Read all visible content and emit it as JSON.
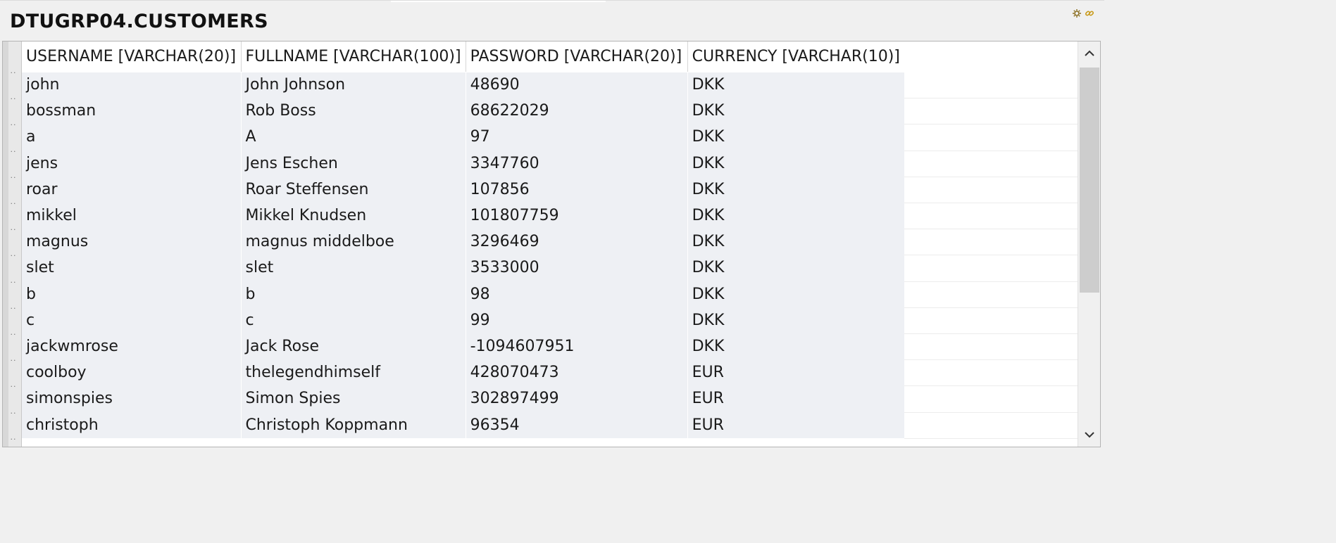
{
  "window": {
    "title": "DTUGRP04.CUSTOMERS"
  },
  "toolbar": {
    "icons": [
      "settings-icon",
      "link-icon"
    ]
  },
  "table": {
    "columns": [
      "USERNAME [VARCHAR(20)]",
      "FULLNAME [VARCHAR(100)]",
      "PASSWORD [VARCHAR(20)]",
      "CURRENCY [VARCHAR(10)]"
    ],
    "rows": [
      [
        "john",
        "John Johnson",
        "48690",
        "DKK"
      ],
      [
        "bossman",
        "Rob Boss",
        "68622029",
        "DKK"
      ],
      [
        "a",
        "A",
        "97",
        "DKK"
      ],
      [
        "jens",
        "Jens Eschen",
        "3347760",
        "DKK"
      ],
      [
        "roar",
        "Roar Steffensen",
        "107856",
        "DKK"
      ],
      [
        "mikkel",
        "Mikkel Knudsen",
        "101807759",
        "DKK"
      ],
      [
        "magnus",
        "magnus middelboe",
        "3296469",
        "DKK"
      ],
      [
        "slet",
        "slet",
        "3533000",
        "DKK"
      ],
      [
        "b",
        "b",
        "98",
        "DKK"
      ],
      [
        "c",
        "c",
        "99",
        "DKK"
      ],
      [
        "jackwmrose",
        "Jack Rose",
        "-1094607951",
        "DKK"
      ],
      [
        "coolboy",
        "thelegendhimself",
        "428070473",
        "EUR"
      ],
      [
        "simonspies",
        "Simon Spies",
        "302897499",
        "EUR"
      ],
      [
        "christoph",
        "Christoph Koppmann",
        "96354",
        "EUR"
      ]
    ]
  },
  "colors": {
    "cell_bg": "#eef0f4",
    "header_bg": "#ffffff",
    "scroll_thumb": "#cdcdcd"
  }
}
